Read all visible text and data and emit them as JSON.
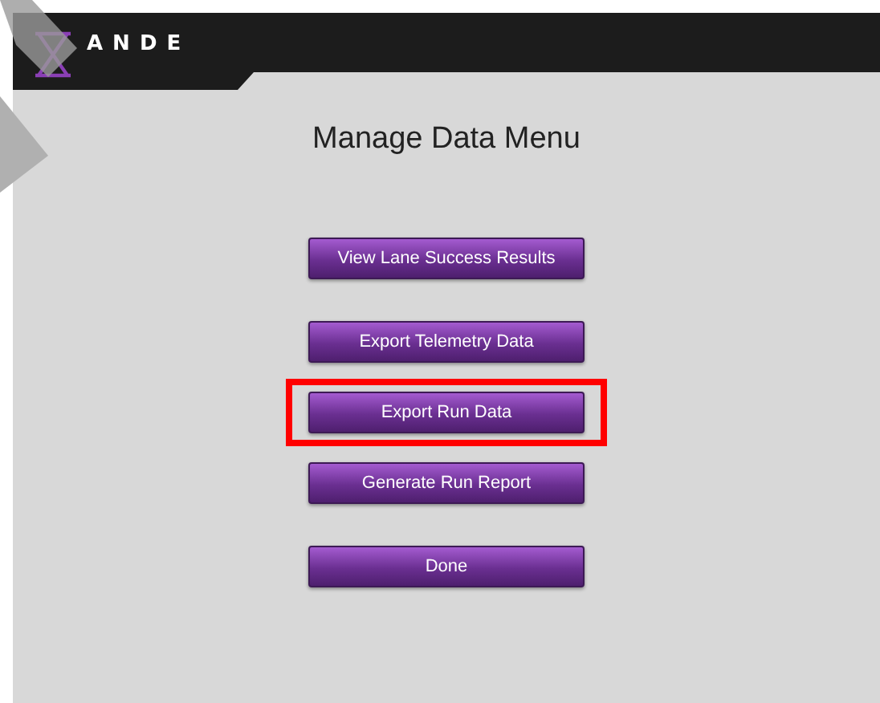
{
  "header": {
    "logo_text": "ANDE"
  },
  "title": "Manage Data Menu",
  "buttons": [
    {
      "label": "View Lane Success Results",
      "highlighted": false
    },
    {
      "label": "Export Telemetry Data",
      "highlighted": false
    },
    {
      "label": "Export Run Data",
      "highlighted": true
    },
    {
      "label": "Generate Run Report",
      "highlighted": false
    },
    {
      "label": "Done",
      "highlighted": false
    }
  ]
}
